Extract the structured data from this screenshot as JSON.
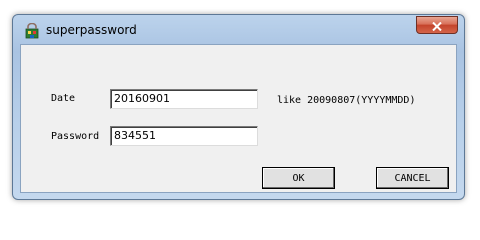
{
  "window": {
    "title": "superpassword",
    "icon": "app-icon",
    "close_icon": "close-icon"
  },
  "form": {
    "date_label": "Date",
    "date_value": "20160901",
    "date_hint": "like 20090807(YYYYMMDD)",
    "password_label": "Password",
    "password_value": "834551"
  },
  "buttons": {
    "ok_label": "OK",
    "cancel_label": "CANCEL"
  },
  "colors": {
    "titlebar": "#b8d0ea",
    "close_button": "#c4432b",
    "client_background": "#f0f0f0"
  }
}
